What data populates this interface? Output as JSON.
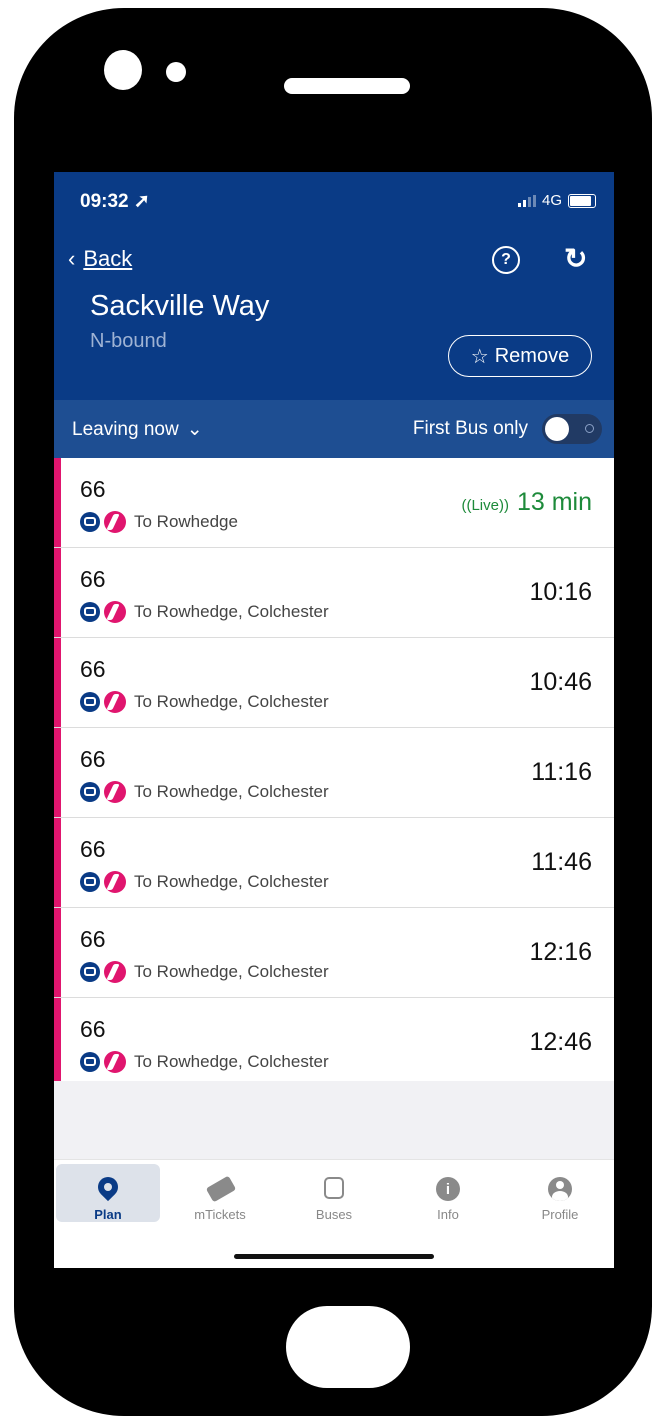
{
  "status": {
    "time": "09:32 ➚",
    "network": "4G"
  },
  "header": {
    "back_label": "Back",
    "stop_name": "Sackville Way",
    "direction": "N-bound",
    "remove_label": "Remove"
  },
  "filters": {
    "leaving_label": "Leaving now",
    "first_bus_label": "First Bus only",
    "first_bus_enabled": false
  },
  "departures": [
    {
      "route": "66",
      "destination": "To Rowhedge",
      "live_badge": "((Live))",
      "time": "13 min",
      "live": true
    },
    {
      "route": "66",
      "destination": "To Rowhedge, Colchester",
      "time": "10:16",
      "live": false
    },
    {
      "route": "66",
      "destination": "To Rowhedge, Colchester",
      "time": "10:46",
      "live": false
    },
    {
      "route": "66",
      "destination": "To Rowhedge, Colchester",
      "time": "11:16",
      "live": false
    },
    {
      "route": "66",
      "destination": "To Rowhedge, Colchester",
      "time": "11:46",
      "live": false
    },
    {
      "route": "66",
      "destination": "To Rowhedge, Colchester",
      "time": "12:16",
      "live": false
    },
    {
      "route": "66",
      "destination": "To Rowhedge, Colchester",
      "time": "12:46",
      "live": false
    }
  ],
  "tabs": [
    {
      "label": "Plan",
      "icon": "location-pin-icon",
      "active": true
    },
    {
      "label": "mTickets",
      "icon": "ticket-icon",
      "active": false
    },
    {
      "label": "Buses",
      "icon": "bus-icon",
      "active": false
    },
    {
      "label": "Info",
      "icon": "info-icon",
      "active": false
    },
    {
      "label": "Profile",
      "icon": "profile-icon",
      "active": false
    }
  ],
  "colors": {
    "header_bg": "#0a3b86",
    "filter_bg": "#1e4e92",
    "accent_pink": "#e0156e",
    "live_green": "#1d8a3a"
  }
}
